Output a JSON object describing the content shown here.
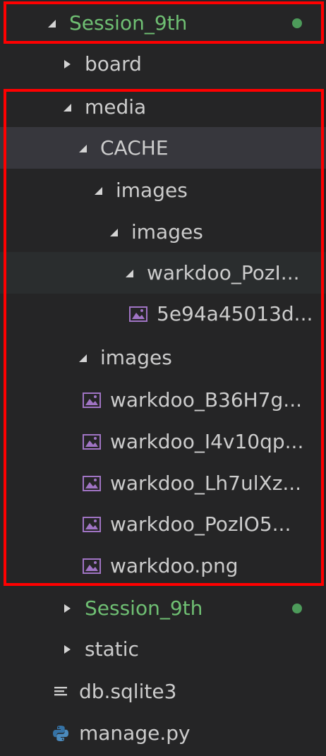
{
  "tree": {
    "rows": [
      {
        "label": "Session_9th",
        "kind": "folder",
        "expanded": true,
        "indent": 0,
        "color": "green",
        "dot": true
      },
      {
        "label": "board",
        "kind": "folder",
        "expanded": false,
        "indent": 1
      },
      {
        "label": "media",
        "kind": "folder",
        "expanded": true,
        "indent": 1
      },
      {
        "label": "CACHE",
        "kind": "folder",
        "expanded": true,
        "indent": 2,
        "state": "selected"
      },
      {
        "label": "images",
        "kind": "folder",
        "expanded": true,
        "indent": 3
      },
      {
        "label": "images",
        "kind": "folder",
        "expanded": true,
        "indent": 4
      },
      {
        "label": "warkdoo_PozI...",
        "kind": "folder",
        "expanded": true,
        "indent": 5,
        "state": "hover"
      },
      {
        "label": "5e94a45013d...",
        "kind": "image",
        "indent": 6
      },
      {
        "label": "images",
        "kind": "folder",
        "expanded": true,
        "indent": 2
      },
      {
        "label": "warkdoo_B36H7g...",
        "kind": "image",
        "indent": 3
      },
      {
        "label": "warkdoo_I4v10qp...",
        "kind": "image",
        "indent": 3
      },
      {
        "label": "warkdoo_Lh7ulXz...",
        "kind": "image",
        "indent": 3
      },
      {
        "label": "warkdoo_PozIO5...",
        "kind": "image",
        "indent": 3
      },
      {
        "label": "warkdoo.png",
        "kind": "image",
        "indent": 3
      },
      {
        "label": "Session_9th",
        "kind": "folder",
        "expanded": false,
        "indent": 1,
        "color": "green",
        "dot": true
      },
      {
        "label": "static",
        "kind": "folder",
        "expanded": false,
        "indent": 1
      },
      {
        "label": "db.sqlite3",
        "kind": "text-file",
        "indent": 1
      },
      {
        "label": "manage.py",
        "kind": "python-file",
        "indent": 1
      }
    ]
  },
  "colors": {
    "background": "#252526",
    "text": "#cccccc",
    "git_green": "#6fbf73",
    "image_icon": "#a074c4",
    "python_icon": "#3572a5",
    "highlight": "#ff0000"
  }
}
